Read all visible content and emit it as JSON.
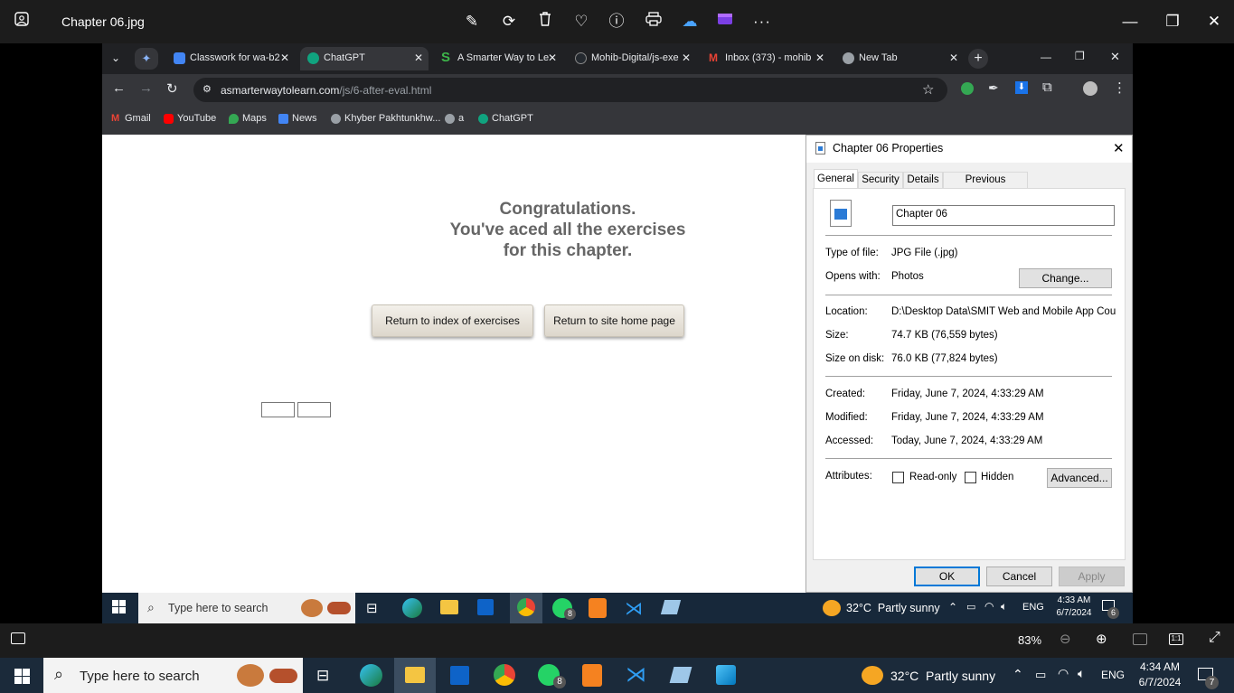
{
  "viewer": {
    "title": "Chapter 06.jpg",
    "zoom": "83%"
  },
  "browser": {
    "tabs": [
      {
        "label": "Classwork for wa-b2",
        "color": "#4285f4"
      },
      {
        "label": "ChatGPT",
        "color": "#10a37f"
      },
      {
        "label": "A Smarter Way to Le",
        "color": "#3db54a"
      },
      {
        "label": "Mohib-Digital/js-exe",
        "color": "#24292f"
      },
      {
        "label": "Inbox (373) - mohib",
        "color": "#ea4335"
      },
      {
        "label": "New Tab",
        "color": "#9aa0a6"
      }
    ],
    "url_host": "asmarterwaytolearn.com",
    "url_path": "/js/6-after-eval.html",
    "bookmarks": [
      {
        "label": "Gmail",
        "color": "#ea4335"
      },
      {
        "label": "YouTube",
        "color": "#ff0000"
      },
      {
        "label": "Maps",
        "color": "#34a853"
      },
      {
        "label": "News",
        "color": "#4285f4"
      },
      {
        "label": "Khyber Pakhtunkhw...",
        "color": "#9aa0a6"
      },
      {
        "label": "a",
        "color": "#9aa0a6"
      },
      {
        "label": "ChatGPT",
        "color": "#10a37f"
      }
    ]
  },
  "page": {
    "congrats_line1": "Congratulations.",
    "congrats_line2": "You've aced all the exercises",
    "congrats_line3": "for this chapter.",
    "btn_index": "Return to index of exercises",
    "btn_home": "Return to site home page"
  },
  "dialog": {
    "title": "Chapter 06 Properties",
    "tabs": [
      "General",
      "Security",
      "Details",
      "Previous Versions"
    ],
    "filename": "Chapter 06",
    "type_label": "Type of file:",
    "type_value": "JPG File (.jpg)",
    "opens_label": "Opens with:",
    "opens_value": "Photos",
    "change_btn": "Change...",
    "location_label": "Location:",
    "location_value": "D:\\Desktop Data\\SMIT Web and Mobile App Cours",
    "size_label": "Size:",
    "size_value": "74.7 KB (76,559 bytes)",
    "disk_label": "Size on disk:",
    "disk_value": "76.0 KB (77,824 bytes)",
    "created_label": "Created:",
    "created_value": "Friday, June 7, 2024, 4:33:29 AM",
    "modified_label": "Modified:",
    "modified_value": "Friday, June 7, 2024, 4:33:29 AM",
    "accessed_label": "Accessed:",
    "accessed_value": "Today, June 7, 2024, 4:33:29 AM",
    "attr_label": "Attributes:",
    "readonly_label": "Read-only",
    "hidden_label": "Hidden",
    "advanced_btn": "Advanced...",
    "ok": "OK",
    "cancel": "Cancel",
    "apply": "Apply"
  },
  "inner_taskbar": {
    "search": "Type here to search",
    "weather": "32°C  Partly sunny",
    "lang": "ENG",
    "time": "4:33 AM",
    "date": "6/7/2024",
    "whatsapp_badge": "8",
    "notif_badge": "6"
  },
  "taskbar": {
    "search": "Type here to search",
    "weather": "32°C  Partly sunny",
    "lang": "ENG",
    "time": "4:34 AM",
    "date": "6/7/2024",
    "whatsapp_badge": "8",
    "notif_badge": "7"
  }
}
